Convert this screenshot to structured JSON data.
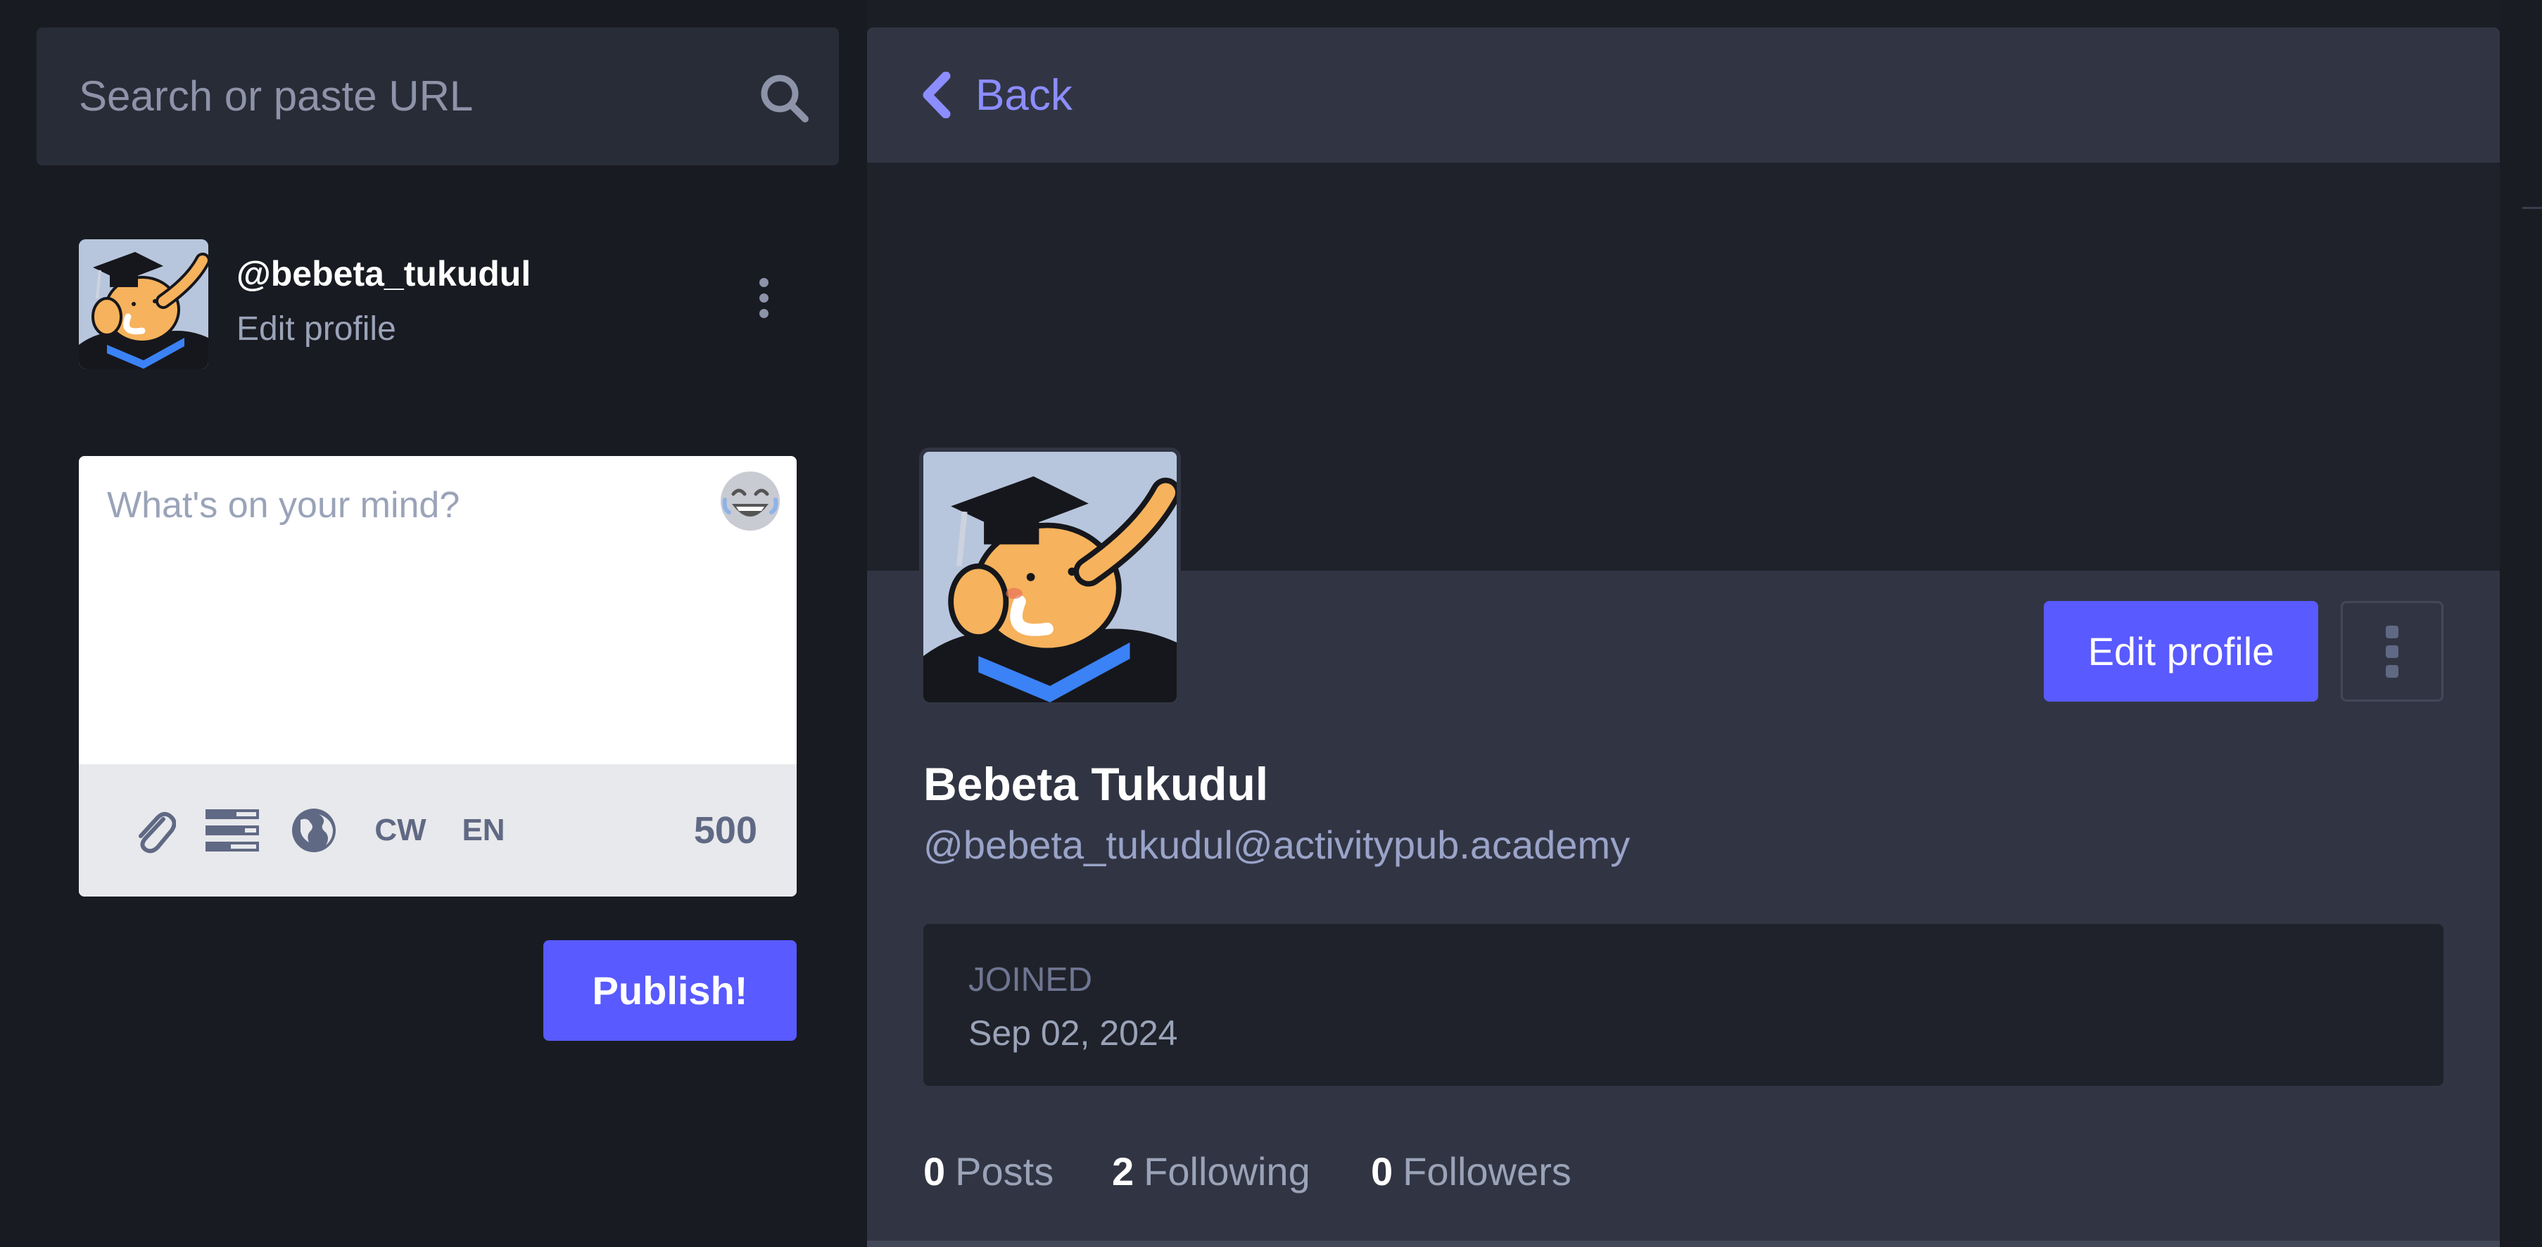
{
  "search": {
    "placeholder": "Search or paste URL",
    "icon": "search-icon"
  },
  "current_user": {
    "account": "@bebeta_tukudul",
    "edit_label": "Edit profile",
    "menu_icon": "vertical-dots-icon"
  },
  "composer": {
    "placeholder": "What's on your mind?",
    "emoji_icon": "laughing-emoji-icon",
    "tools": {
      "attach_icon": "paperclip-icon",
      "poll_icon": "poll-icon",
      "visibility_icon": "globe-icon",
      "cw_label": "CW",
      "language_label": "EN"
    },
    "char_counter": "500",
    "publish_label": "Publish!"
  },
  "profile": {
    "back_label": "Back",
    "back_icon": "chevron-left-icon",
    "edit_profile_label": "Edit profile",
    "menu_icon": "vertical-dots-icon",
    "display_name": "Bebeta Tukudul",
    "handle": "@bebeta_tukudul@activitypub.academy",
    "joined_label": "JOINED",
    "joined_date": "Sep 02, 2024",
    "stats": [
      {
        "count": "0",
        "label": "Posts"
      },
      {
        "count": "2",
        "label": "Following"
      },
      {
        "count": "0",
        "label": "Followers"
      }
    ]
  },
  "colors": {
    "accent": "#595aff",
    "link": "#8c8dff",
    "background": "#191b22",
    "panel": "#313543"
  }
}
